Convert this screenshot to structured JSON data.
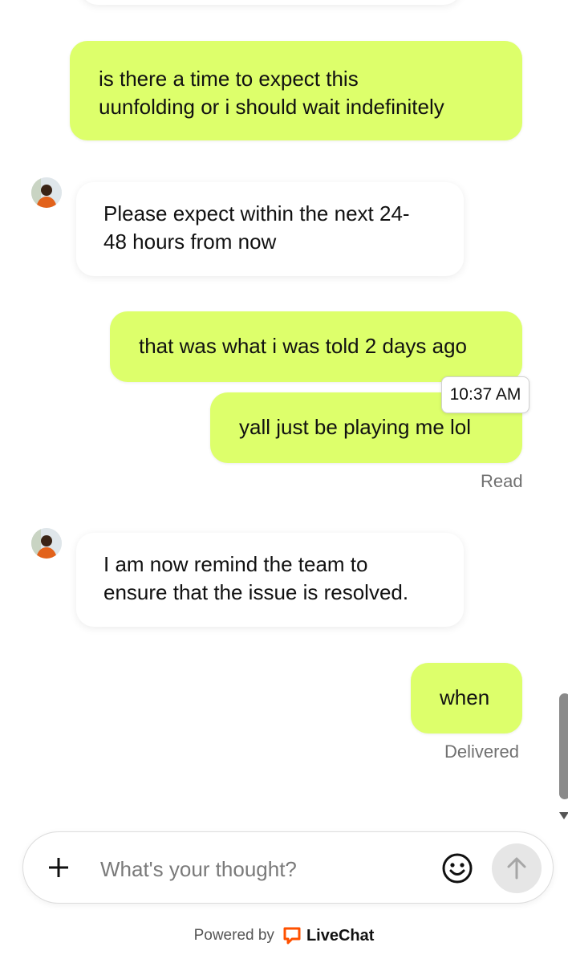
{
  "messages": [
    {
      "id": "m1",
      "direction": "outgoing",
      "text_lines": [
        "is there a time to expect this",
        "uunfolding or i should wait indefinitely"
      ]
    },
    {
      "id": "m2",
      "direction": "incoming",
      "text_lines": [
        "Please expect within the next 24-",
        "48 hours from now"
      ]
    },
    {
      "id": "m3",
      "direction": "outgoing",
      "text_lines": [
        "that was what i was told 2 days ago"
      ]
    },
    {
      "id": "m4",
      "direction": "outgoing",
      "text_lines": [
        "yall just be playing me lol"
      ]
    },
    {
      "id": "m5",
      "direction": "incoming",
      "text_lines": [
        "I am now remind the team to",
        "ensure that the issue is resolved."
      ]
    },
    {
      "id": "m6",
      "direction": "outgoing",
      "text_lines": [
        "when"
      ]
    }
  ],
  "tooltip_time": "10:37 AM",
  "status_read": "Read",
  "status_delivered": "Delivered",
  "composer": {
    "placeholder": "What's your thought?",
    "value": ""
  },
  "footer": {
    "powered_by": "Powered by",
    "brand": "LiveChat"
  },
  "colors": {
    "outgoing_bubble": "#ddff6b",
    "incoming_bubble": "#ffffff",
    "brand_orange": "#ff5100"
  },
  "icons": {
    "plus": "plus-icon",
    "emoji": "smiley-icon",
    "send": "arrow-up-icon",
    "logo": "livechat-logo-icon"
  }
}
